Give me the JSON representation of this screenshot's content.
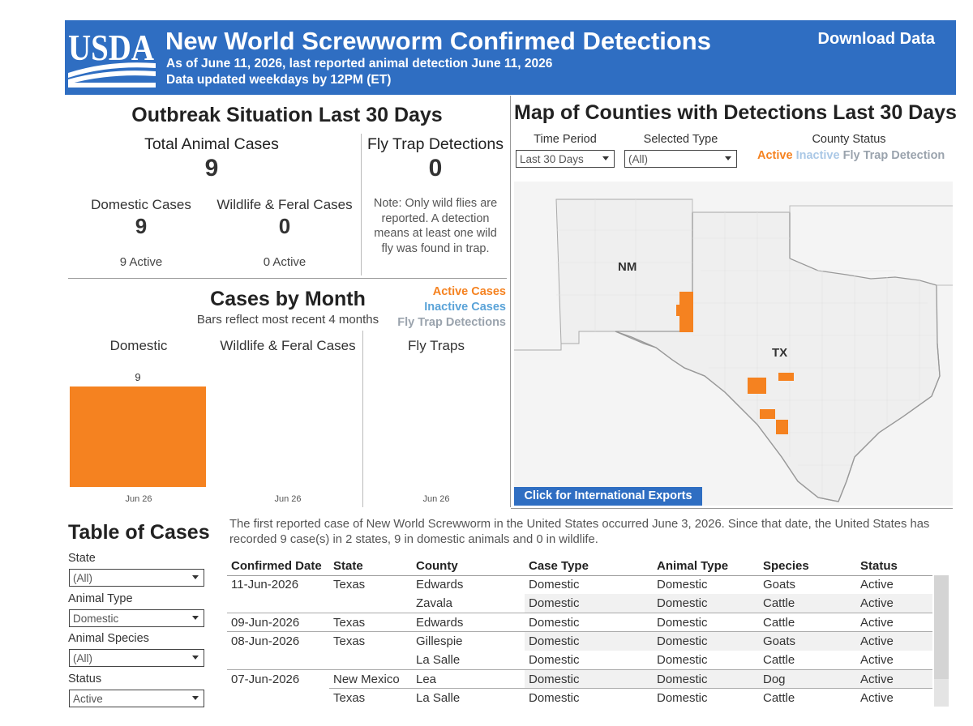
{
  "header": {
    "logo_text": "USDA",
    "title": "New World Screwworm Confirmed Detections",
    "subtitle_1": "As of June 11, 2026, last reported animal detection June 11, 2026",
    "subtitle_2": "Data updated weekdays by 12PM (ET)",
    "download_label": "Download Data",
    "color": "#2f6ec2"
  },
  "outbreak": {
    "title": "Outbreak Situation Last 30 Days",
    "total_label": "Total Animal Cases",
    "total_value": "9",
    "flytrap_label": "Fly Trap Detections",
    "flytrap_value": "0",
    "flytrap_note": [
      "Note: Only wild flies are",
      "reported. A detection",
      "means at least one wild",
      "fly was found in trap."
    ],
    "domestic_label": "Domestic Cases",
    "domestic_value": "9",
    "domestic_active": "9 Active",
    "wildlife_label": "Wildlife & Feral Cases",
    "wildlife_value": "0",
    "wildlife_active": "0 Active"
  },
  "month": {
    "title": "Cases by Month",
    "subtitle": "Bars reflect most recent 4 months",
    "legend": [
      {
        "label": "Active Cases",
        "color": "#f58220"
      },
      {
        "label": "Inactive Cases",
        "color": "#5aa3d8"
      },
      {
        "label": "Fly Trap Detections",
        "color": "#9aa3ad"
      }
    ],
    "panels": [
      "Domestic",
      "Wildlife & Feral Cases",
      "Fly Traps"
    ]
  },
  "chart_data": {
    "type": "bar",
    "categories": [
      "Jun 26"
    ],
    "series": [
      {
        "name": "Domestic",
        "values": [
          9
        ]
      },
      {
        "name": "Wildlife & Feral Cases",
        "values": [
          0
        ]
      },
      {
        "name": "Fly Traps",
        "values": [
          0
        ]
      }
    ],
    "bar_color": "#f58220",
    "data_label": "9"
  },
  "map": {
    "title": "Map of Counties with Detections Last 30 Days",
    "time_period_label": "Time Period",
    "time_period_value": "Last 30 Days",
    "selected_type_label": "Selected Type",
    "selected_type_value": "(All)",
    "county_status_label": "County Status",
    "status_legend": [
      {
        "label": "Active",
        "color": "#f58220"
      },
      {
        "label": "Inactive",
        "color": "#aac8e6"
      },
      {
        "label": "Fly Trap Detection",
        "color": "#9aa3ad"
      }
    ],
    "state_labels": [
      "NM",
      "TX"
    ],
    "export_button": "Click for International Exports"
  },
  "table_section": {
    "title": "Table of Cases",
    "intro_1": "The first reported case of New World Screwworm in the United States occurred June 3, 2026. Since that date, the United States has",
    "intro_2": "recorded 9 case(s) in 2 states, 9 in domestic animals and 0 in wildlife.",
    "filters": [
      {
        "label": "State",
        "value": "(All)"
      },
      {
        "label": "Animal Type",
        "value": "Domestic"
      },
      {
        "label": "Animal Species",
        "value": "(All)"
      },
      {
        "label": "Status",
        "value": "Active"
      }
    ],
    "columns": [
      "Confirmed Date",
      "State",
      "County",
      "Case Type",
      "Animal Type",
      "Species",
      "Status"
    ],
    "rows": [
      {
        "date": "11-Jun-2026",
        "state": "Texas",
        "county": "Edwards",
        "case_type": "Domestic",
        "animal_type": "Domestic",
        "species": "Goats",
        "status": "Active",
        "group_start": true
      },
      {
        "date": "",
        "state": "",
        "county": "Zavala",
        "case_type": "Domestic",
        "animal_type": "Domestic",
        "species": "Cattle",
        "status": "Active"
      },
      {
        "date": "09-Jun-2026",
        "state": "Texas",
        "county": "Edwards",
        "case_type": "Domestic",
        "animal_type": "Domestic",
        "species": "Cattle",
        "status": "Active",
        "group_start": true
      },
      {
        "date": "08-Jun-2026",
        "state": "Texas",
        "county": "Gillespie",
        "case_type": "Domestic",
        "animal_type": "Domestic",
        "species": "Goats",
        "status": "Active",
        "group_start": true
      },
      {
        "date": "",
        "state": "",
        "county": "La Salle",
        "case_type": "Domestic",
        "animal_type": "Domestic",
        "species": "Cattle",
        "status": "Active"
      },
      {
        "date": "07-Jun-2026",
        "state": "New Mexico",
        "county": "Lea",
        "case_type": "Domestic",
        "animal_type": "Domestic",
        "species": "Dog",
        "status": "Active",
        "group_start": true
      },
      {
        "date": "",
        "state": "Texas",
        "county": "La Salle",
        "case_type": "Domestic",
        "animal_type": "Domestic",
        "species": "Cattle",
        "status": "Active",
        "state_start": true
      }
    ]
  }
}
